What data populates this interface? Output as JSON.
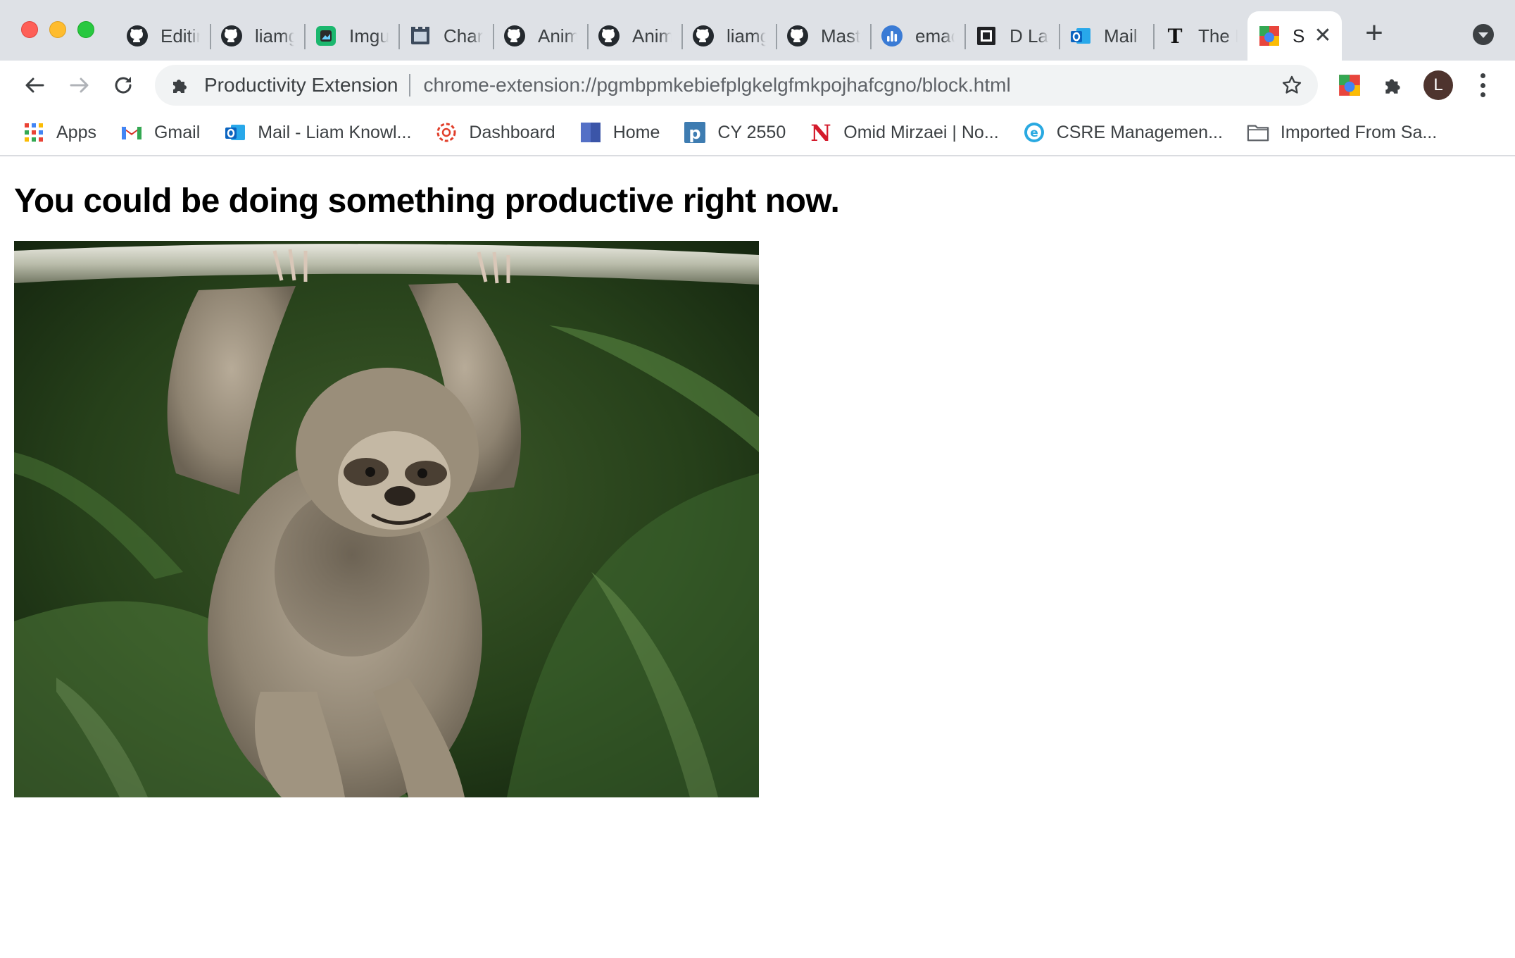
{
  "window": {
    "controls": [
      "close",
      "minimize",
      "zoom"
    ]
  },
  "tabs": [
    {
      "icon": "github-icon",
      "title": "Editir"
    },
    {
      "icon": "github-icon",
      "title": "liamg"
    },
    {
      "icon": "imgur-icon",
      "title": "Imgu"
    },
    {
      "icon": "film-icon",
      "title": "Char"
    },
    {
      "icon": "github-icon",
      "title": "Anim"
    },
    {
      "icon": "github-icon",
      "title": "Anim"
    },
    {
      "icon": "github-icon",
      "title": "liamg"
    },
    {
      "icon": "github-icon",
      "title": "Mast"
    },
    {
      "icon": "analytics-icon",
      "title": "emac"
    },
    {
      "icon": "chip-icon",
      "title": "D La"
    },
    {
      "icon": "outlook-icon",
      "title": "Mail"
    },
    {
      "icon": "nyt-icon",
      "title": "The I"
    }
  ],
  "active_tab": {
    "icon": "extension-color-icon",
    "title": "S"
  },
  "toolbar": {
    "site_chip": "Productivity Extension",
    "url": "chrome-extension://pgmbpmkebiefplgkelgfmkpojhafcgno/block.html",
    "avatar_letter": "L"
  },
  "bookmarks": [
    {
      "icon": "apps-grid-icon",
      "label": "Apps"
    },
    {
      "icon": "gmail-icon",
      "label": "Gmail"
    },
    {
      "icon": "outlook-icon",
      "label": "Mail - Liam Knowl..."
    },
    {
      "icon": "canvas-icon",
      "label": "Dashboard"
    },
    {
      "icon": "home-square-icon",
      "label": "Home"
    },
    {
      "icon": "p-logo-icon",
      "label": "CY 2550"
    },
    {
      "icon": "northeastern-icon",
      "label": "Omid Mirzaei | No..."
    },
    {
      "icon": "e-logo-icon",
      "label": "CSRE Managemen..."
    },
    {
      "icon": "folder-icon",
      "label": "Imported From Sa..."
    }
  ],
  "page": {
    "headline": "You could be doing something productive right now.",
    "image": "baby sloth hanging from a branch"
  },
  "colors": {
    "tabstrip_bg": "#dee1e6",
    "omnibox_bg": "#f1f3f4",
    "text": "#3c4043",
    "avatar_bg": "#4e342e"
  }
}
